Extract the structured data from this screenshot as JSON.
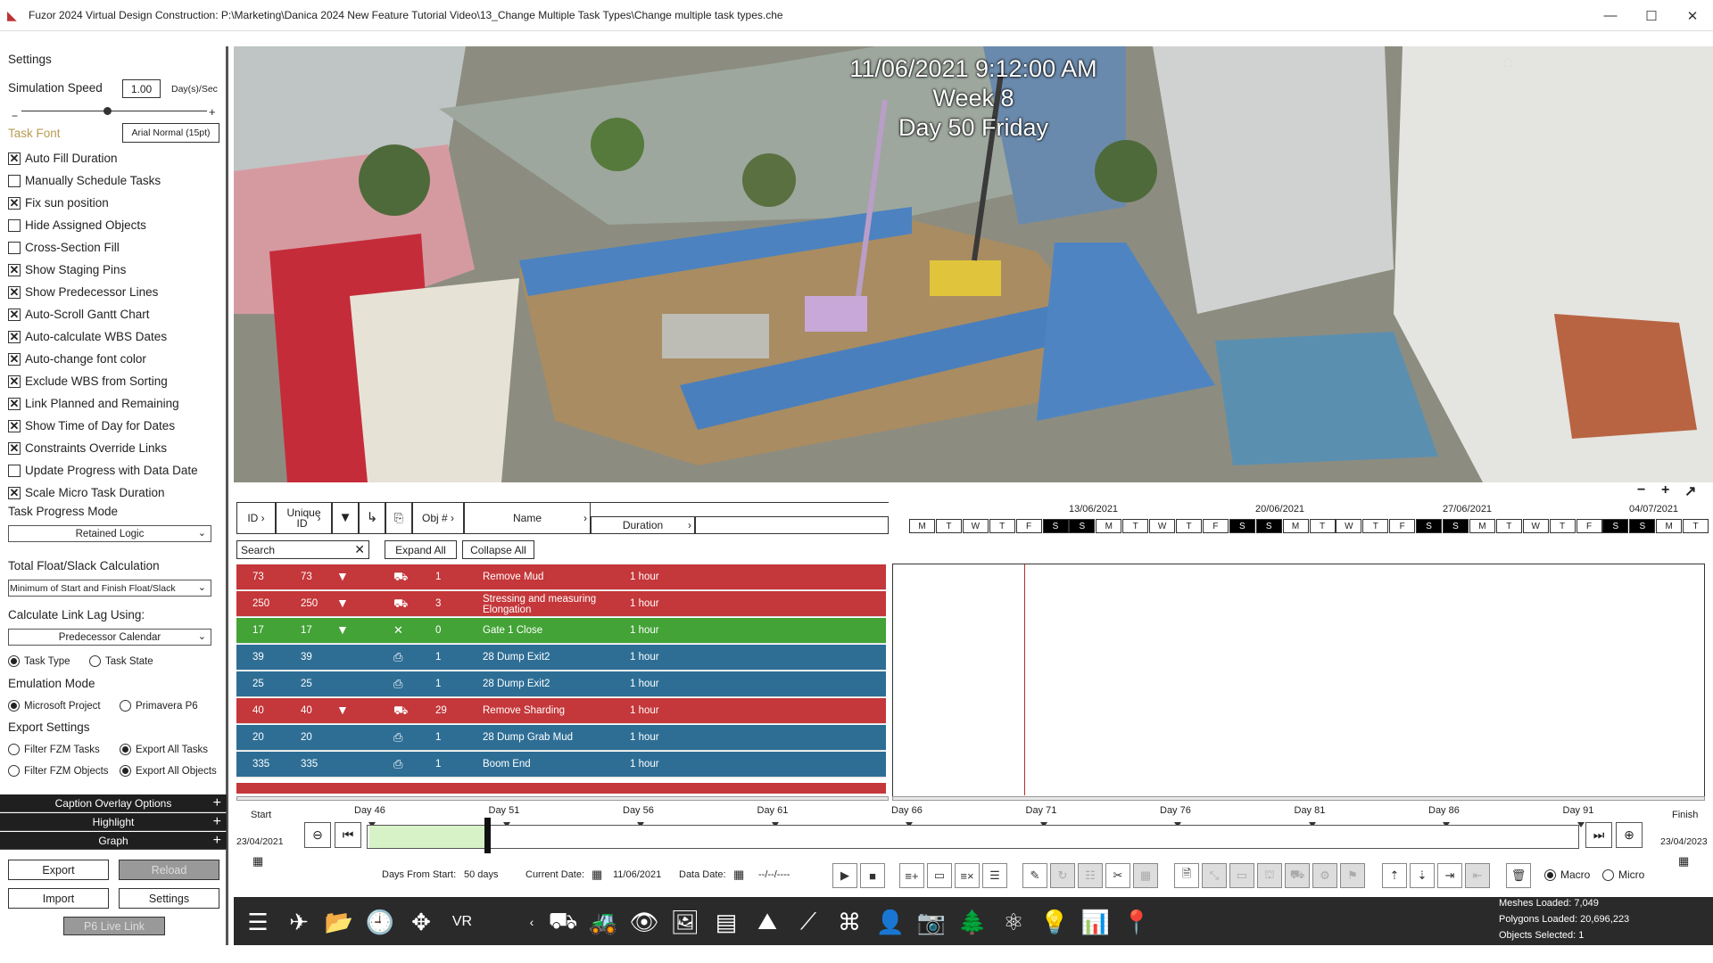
{
  "window": {
    "title": "Fuzor 2024 Virtual Design Construction: P:\\Marketing\\Danica 2024 New Feature Tutorial Video\\13_Change Multiple Task Types\\Change multiple task types.che",
    "minimize": "—",
    "maximize": "☐",
    "close": "✕"
  },
  "settings": {
    "header": "Settings",
    "sim_speed_label": "Simulation Speed",
    "sim_speed_value": "1.00",
    "sim_speed_unit": "Day(s)/Sec",
    "sim_speed_fraction": 0.46,
    "task_font_label": "Task Font",
    "task_font_value": "Arial Normal (15pt)",
    "checkboxes": [
      {
        "label": "Auto Fill Duration",
        "checked": true
      },
      {
        "label": "Manually Schedule Tasks",
        "checked": false
      },
      {
        "label": "Fix sun position",
        "checked": true
      },
      {
        "label": "Hide Assigned Objects",
        "checked": false
      },
      {
        "label": "Cross-Section Fill",
        "checked": false
      },
      {
        "label": "Show Staging Pins",
        "checked": true
      },
      {
        "label": "Show Predecessor Lines",
        "checked": true
      },
      {
        "label": "Auto-Scroll Gantt Chart",
        "checked": true
      },
      {
        "label": "Auto-calculate WBS Dates",
        "checked": true
      },
      {
        "label": "Auto-change font color",
        "checked": true
      },
      {
        "label": "Exclude WBS from Sorting",
        "checked": true
      },
      {
        "label": "Link Planned and Remaining",
        "checked": true
      },
      {
        "label": "Show Time of Day for Dates",
        "checked": true
      },
      {
        "label": "Constraints Override Links",
        "checked": true
      },
      {
        "label": "Update Progress with Data Date",
        "checked": false
      },
      {
        "label": "Scale Micro Task Duration",
        "checked": true
      }
    ],
    "progress_mode_label": "Task Progress Mode",
    "progress_mode_value": "Retained Logic",
    "float_label": "Total Float/Slack Calculation",
    "float_value": "Minimum of Start and Finish Float/Slack",
    "link_lag_label": "Calculate Link Lag Using:",
    "link_lag_value": "Predecessor Calendar",
    "task_type": "Task Type",
    "task_state": "Task State",
    "emulation_label": "Emulation Mode",
    "ms_project": "Microsoft Project",
    "primavera": "Primavera P6",
    "export_settings_label": "Export Settings",
    "filter_tasks": "Filter FZM Tasks",
    "export_tasks": "Export All Tasks",
    "filter_objects": "Filter FZM Objects",
    "export_objects": "Export All Objects",
    "caption_overlay": "Caption Overlay Options",
    "highlight": "Highlight",
    "graph": "Graph",
    "export_btn": "Export",
    "reload_btn": "Reload",
    "import_btn": "Import",
    "settings_btn": "Settings",
    "p6_btn": "P6 Live Link"
  },
  "viewport": {
    "datetime": "11/06/2021 9:12:00 AM",
    "week": "Week 8",
    "day": "Day 50 Friday"
  },
  "gantt": {
    "columns": {
      "id": "ID",
      "unique_id": "Unique ID",
      "obj": "Obj #",
      "name": "Name",
      "duration": "Duration"
    },
    "search_placeholder": "Search",
    "expand_all": "Expand All",
    "collapse_all": "Collapse All",
    "date_headers": [
      "13/06/2021",
      "20/06/2021",
      "27/06/2021",
      "04/07/2021"
    ],
    "days": [
      "M",
      "T",
      "W",
      "T",
      "F",
      "S",
      "S",
      "M",
      "T",
      "W",
      "T",
      "F",
      "S",
      "S",
      "M",
      "T",
      "W",
      "T",
      "F",
      "S",
      "S",
      "M",
      "T",
      "W",
      "T",
      "F",
      "S",
      "S",
      "M",
      "T"
    ],
    "tasks": [
      {
        "id": "73",
        "uid": "73",
        "obj": "1",
        "name": "Remove Mud",
        "dur": "1 hour",
        "color": "#c4373a"
      },
      {
        "id": "250",
        "uid": "250",
        "obj": "3",
        "name": "Stressing and measuring Elongation",
        "dur": "1 hour",
        "color": "#c4373a"
      },
      {
        "id": "17",
        "uid": "17",
        "obj": "0",
        "name": "Gate 1 Close",
        "dur": "1 hour",
        "color": "#43a337"
      },
      {
        "id": "39",
        "uid": "39",
        "obj": "1",
        "name": "28 Dump Exit2",
        "dur": "1 hour",
        "color": "#2e6e95"
      },
      {
        "id": "25",
        "uid": "25",
        "obj": "1",
        "name": "28 Dump Exit2",
        "dur": "1 hour",
        "color": "#2e6e95"
      },
      {
        "id": "40",
        "uid": "40",
        "obj": "29",
        "name": "Remove Sharding",
        "dur": "1 hour",
        "color": "#c4373a"
      },
      {
        "id": "20",
        "uid": "20",
        "obj": "1",
        "name": "28 Dump Grab Mud",
        "dur": "1 hour",
        "color": "#2e6e95"
      },
      {
        "id": "335",
        "uid": "335",
        "obj": "1",
        "name": "Boom End",
        "dur": "1 hour",
        "color": "#2e6e95"
      }
    ]
  },
  "timeline": {
    "start_label": "Start",
    "finish_label": "Finish",
    "start_date": "23/04/2021",
    "finish_date": "23/04/2023",
    "day_ticks": [
      "Day 46",
      "Day 51",
      "Day 56",
      "Day 61",
      "Day 66",
      "Day 71",
      "Day 76",
      "Day 81",
      "Day 86",
      "Day 91"
    ],
    "days_from_start_label": "Days From Start:",
    "days_from_start": "50 days",
    "current_date_label": "Current Date:",
    "current_date": "11/06/2021",
    "data_date_label": "Data Date:",
    "data_date": "--/--/----",
    "macro": "Macro",
    "micro": "Micro"
  },
  "stats": {
    "meshes": "Meshes Loaded: 7,049",
    "polygons": "Polygons Loaded: 20,696,223",
    "objects": "Objects Selected: 1"
  }
}
